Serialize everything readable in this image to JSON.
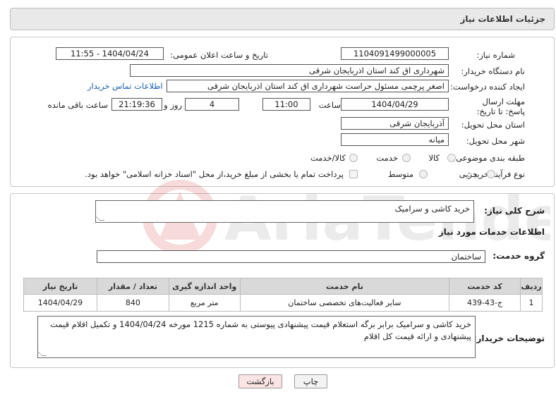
{
  "header": {
    "title": "جزئیات اطلاعات نیاز"
  },
  "form": {
    "need_number_label": "شماره نیاز:",
    "need_number": "1104091499000005",
    "announce_label": "تاریخ و ساعت اعلان عمومی:",
    "announce_value": "1404/04/24 - 11:55",
    "buyer_org_label": "نام دستگاه خریدار:",
    "buyer_org": "شهرداری اق کند استان اذربایجان شرقی",
    "creator_label": "ایجاد کننده درخواست:",
    "creator": "اصغر پرچمی مسئول حراست شهرداری اق کند استان اذربایجان شرقی",
    "buyer_contact_link": "اطلاعات تماس خریدار",
    "deadline_label": "مهلت ارسال پاسخ: تا تاریخ:",
    "deadline_date": "1404/04/29",
    "time_label": "ساعت",
    "deadline_time": "11:00",
    "days_value": "4",
    "days_label": "روز و",
    "remaining_time": "21:19:36",
    "remaining_label": "ساعت باقی مانده",
    "province_label": "استان محل تحویل:",
    "province": "آذربایجان شرقی",
    "city_label": "شهر محل تحویل:",
    "city": "میانه",
    "category_label": "طبقه بندی موضوعی:",
    "category_options": [
      "کالا",
      "خدمت",
      "کالا/خدمت"
    ],
    "process_label": "نوع فرآیند خرید :",
    "process_options": [
      "جزیی",
      "متوسط"
    ],
    "payment_note": "پرداخت تمام یا بخشی از مبلغ خرید،از محل \"اسناد خزانه اسلامی\" خواهد بود."
  },
  "details": {
    "summary_label": "شرح کلی نیاز:",
    "summary": "خرید کاشی و سرامیک",
    "services_heading": "اطلاعات خدمات مورد نیاز",
    "service_group_label": "گروه خدمت:",
    "service_group": "ساختمان",
    "table": {
      "headers": [
        "ردیف",
        "کد خدمت",
        "نام خدمت",
        "واحد اندازه گیری",
        "تعداد / مقدار",
        "تاریخ نیاز"
      ],
      "rows": [
        [
          "1",
          "ج-43-439",
          "سایر فعالیت‌های تخصصی ساختمان",
          "متر مربع",
          "840",
          "1404/04/29"
        ]
      ]
    },
    "buyer_notes_label": "توضیحات خریدار:",
    "buyer_notes": "خرید کاشی و سرامیک برابر برگه  استعلام قیمت پیشنهادی پیوستی به شماره 1215 مورخه 1404/04/24 و تکمیل اقلام قیمت پیشنهادی و ارائه قیمت کل اقلام"
  },
  "buttons": {
    "print": "چاپ",
    "back": "بازگشت"
  },
  "colors": {
    "link": "#1a5fb4",
    "back_button_bg": "#fde4e4",
    "header_bg": "#e9e9e9"
  }
}
